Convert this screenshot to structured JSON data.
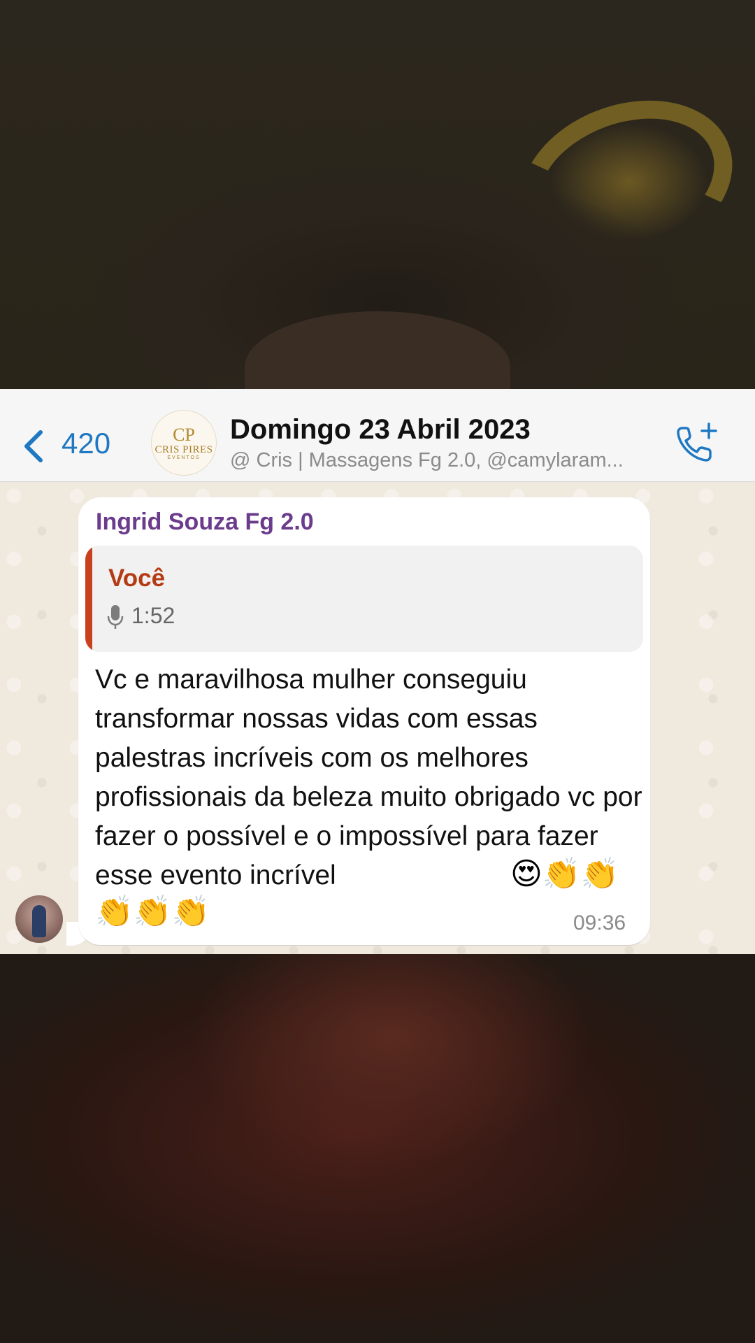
{
  "header": {
    "back_count": "420",
    "group_avatar": {
      "mark": "CP",
      "brand": "CRIS PIRES",
      "sub": "EVENTOS"
    },
    "title": "Domingo 23 Abril 2023",
    "subtitle": "@ Cris | Massagens Fg 2.0, @camylaram..."
  },
  "message": {
    "sender": "Ingrid Souza Fg 2.0",
    "quote": {
      "author": "Você",
      "duration": "1:52"
    },
    "text": "Vc e maravilhosa mulher conseguiu transformar nossas vidas com essas palestras incríveis com os melhores profissionais da beleza muito obrigado vc por fazer o possível e o impossível para fazer esse evento incrível",
    "emojis_line1": "😍👏👏",
    "emojis_line2": "👏👏👏",
    "time": "09:36"
  },
  "colors": {
    "accent_blue": "#1e78c2",
    "sender_purple": "#6b3b8c",
    "quote_orange": "#b43b14",
    "chat_bg": "#efe9de"
  },
  "icons": [
    "chevron-left-icon",
    "phone-add-icon",
    "microphone-icon"
  ]
}
